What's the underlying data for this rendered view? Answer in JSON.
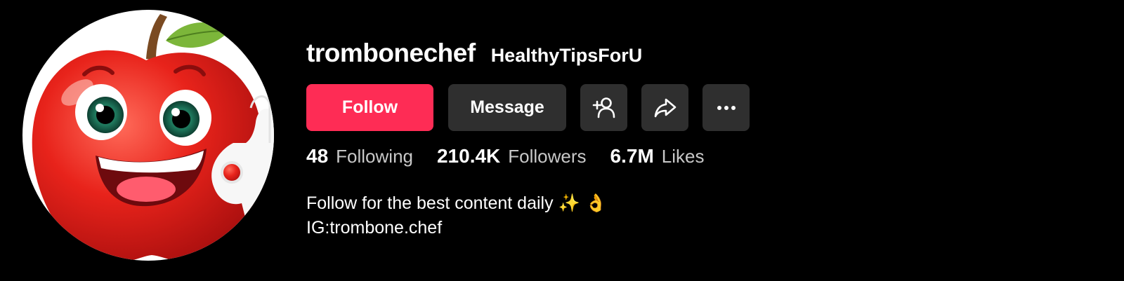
{
  "profile": {
    "username": "trombonechef",
    "display_name": "HealthyTipsForU",
    "avatar_icon": "cartoon-apple-avatar"
  },
  "actions": {
    "follow_label": "Follow",
    "message_label": "Message",
    "add_friend_icon": "add-person-icon",
    "share_icon": "share-arrow-icon",
    "more_icon": "more-dots-icon"
  },
  "stats": {
    "following": {
      "value": "48",
      "label": "Following"
    },
    "followers": {
      "value": "210.4K",
      "label": "Followers"
    },
    "likes": {
      "value": "6.7M",
      "label": "Likes"
    }
  },
  "bio": {
    "line1": "Follow for the best content daily ✨ 👌",
    "line2": "IG:trombone.chef"
  },
  "colors": {
    "background": "#000000",
    "follow_button": "#fe2c55",
    "secondary_button": "#2f2f2f"
  }
}
